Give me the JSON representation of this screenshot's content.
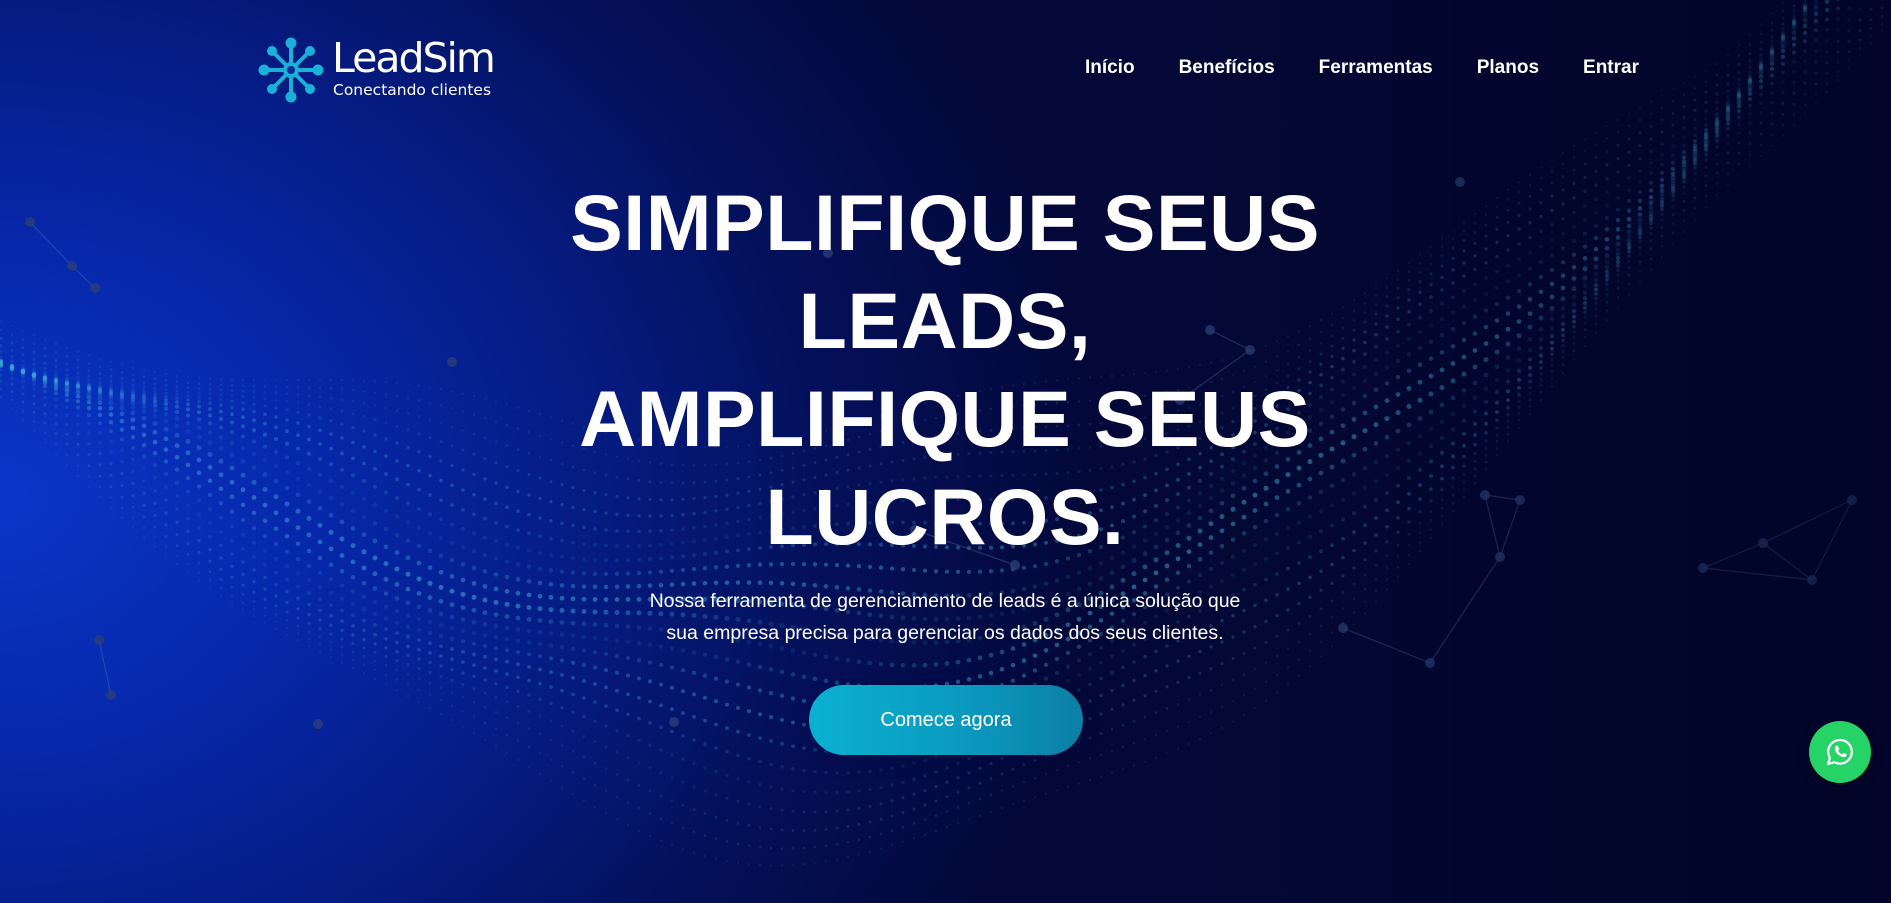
{
  "brand": {
    "name": "LeadSim",
    "tagline": "Conectando clientes",
    "accent_color": "#1ab0d8",
    "logo_icon": "network-nodes-icon"
  },
  "nav": {
    "items": [
      {
        "label": "Início"
      },
      {
        "label": "Benefícios"
      },
      {
        "label": "Ferramentas"
      },
      {
        "label": "Planos"
      },
      {
        "label": "Entrar"
      }
    ]
  },
  "hero": {
    "title_lines": [
      "SIMPLIFIQUE SEUS",
      "LEADS,",
      "AMPLIFIQUE SEUS",
      "LUCROS."
    ],
    "subtitle_lines": [
      "Nossa ferramenta de gerenciamento de leads é a única solução que",
      "sua empresa precisa para gerenciar os dados dos seus clientes."
    ],
    "cta_label": "Comece agora",
    "cta_color": "#0aa3c6"
  },
  "floating": {
    "whatsapp_icon": "whatsapp-icon",
    "whatsapp_color": "#25d366"
  },
  "background": {
    "base_color": "#051b80",
    "dot_color": "#3fa8d8"
  }
}
